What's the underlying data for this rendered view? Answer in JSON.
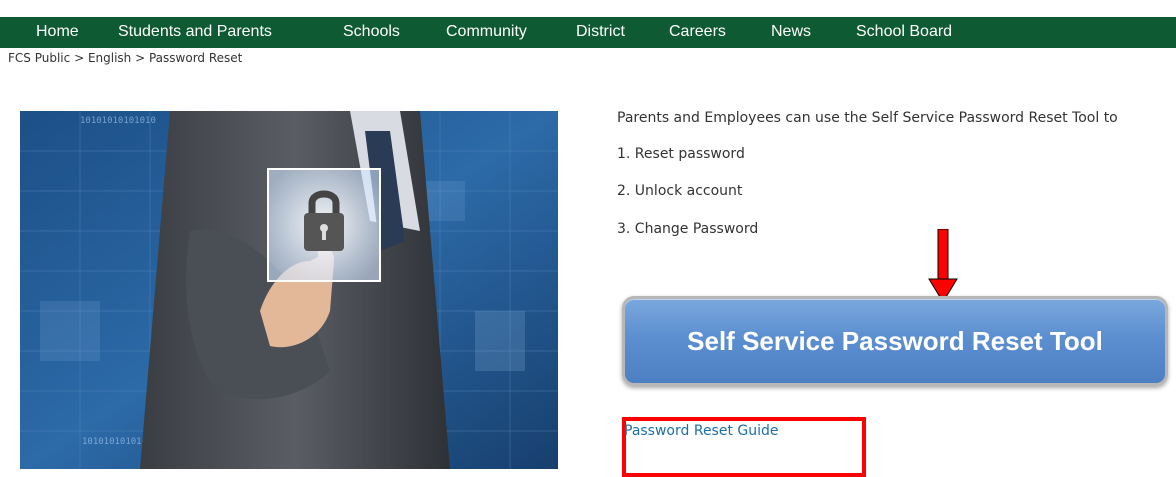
{
  "nav": {
    "items": [
      {
        "label": "Home"
      },
      {
        "label": "Students and Parents"
      },
      {
        "label": "Schools"
      },
      {
        "label": "Community"
      },
      {
        "label": "District"
      },
      {
        "label": "Careers"
      },
      {
        "label": "News"
      },
      {
        "label": "School Board"
      }
    ]
  },
  "breadcrumb": {
    "items": [
      "FCS Public",
      "English",
      "Password Reset"
    ],
    "separator": ">"
  },
  "hero": {
    "binary_text": "10101010101010",
    "icon": "lock-icon"
  },
  "content": {
    "intro": "Parents and Employees can use the Self Service Password Reset Tool to",
    "steps": [
      "1. Reset password",
      "2. Unlock account",
      "3. Change Password"
    ],
    "button_label": "Self Service Password Reset Tool",
    "guide_link": "Password Reset Guide"
  },
  "colors": {
    "nav_bg": "#0e5a32",
    "button_blue": "#5c8fd0",
    "link_blue": "#1d6fa5",
    "annotation_red": "#ff0000"
  }
}
